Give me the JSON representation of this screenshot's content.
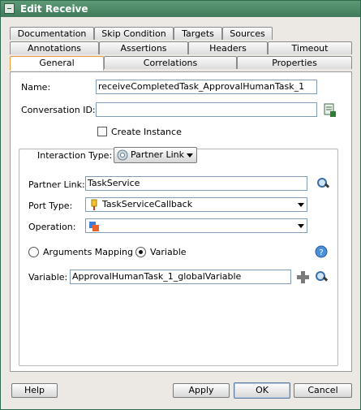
{
  "window": {
    "title": "Edit Receive"
  },
  "tabs": {
    "row1": [
      "Documentation",
      "Skip Condition",
      "Targets",
      "Sources"
    ],
    "row2": [
      "Annotations",
      "Assertions",
      "Headers",
      "Timeout"
    ],
    "row3": [
      "General",
      "Correlations",
      "Properties"
    ],
    "active": "General"
  },
  "general": {
    "name_label": "Name:",
    "name_value": "receiveCompletedTask_ApprovalHumanTask_1",
    "conversation_label": "Conversation ID:",
    "conversation_value": "",
    "create_instance_label": "Create Instance",
    "create_instance_checked": false
  },
  "interaction": {
    "type_label": "Interaction Type:",
    "type_value": "Partner Link",
    "partner_link_label": "Partner Link:",
    "partner_link_value": "TaskService",
    "port_type_label": "Port Type:",
    "port_type_value": "TaskServiceCallback",
    "operation_label": "Operation:",
    "operation_value": "",
    "arguments_mapping_label": "Arguments Mapping",
    "variable_option_label": "Variable",
    "selected_mode": "Variable",
    "variable_label": "Variable:",
    "variable_value": "ApprovalHumanTask_1_globalVariable"
  },
  "buttons": {
    "help": "Help",
    "apply": "Apply",
    "ok": "OK",
    "cancel": "Cancel"
  },
  "icons": {
    "title": "window-menu-icon",
    "conversation": "conversation-id-icon",
    "interaction": "partner-link-icon",
    "search": "search-icon",
    "port": "port-type-icon",
    "operation": "operation-icon",
    "help_circle": "help-circle-icon",
    "add": "plus-icon"
  },
  "colors": {
    "titlebar": "#4a8765",
    "active_tab": "#e89a3b",
    "dialog_bg": "#ece9e4"
  }
}
